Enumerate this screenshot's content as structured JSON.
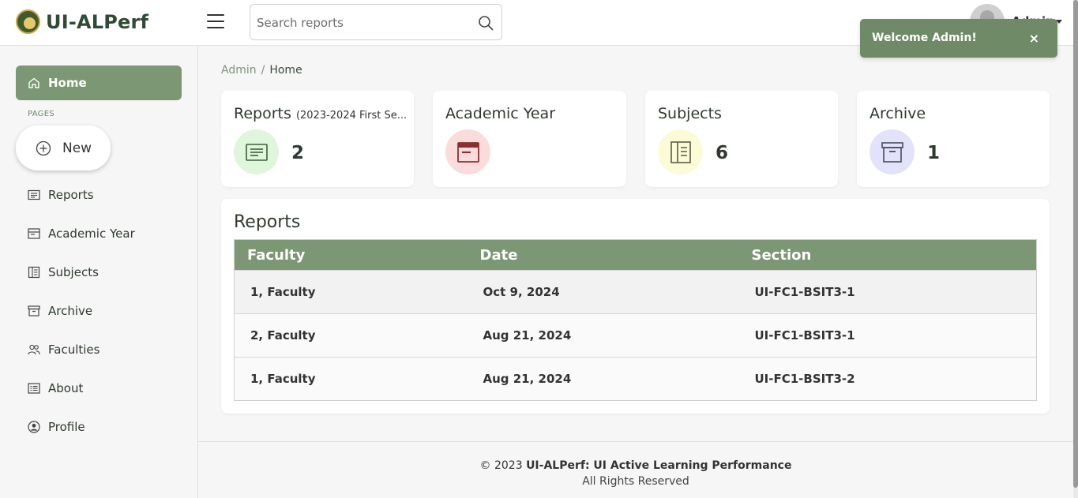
{
  "header": {
    "app_name": "UI-ALPerf",
    "search_placeholder": "Search reports",
    "user_name": "Admin"
  },
  "toast": {
    "message": "Welcome Admin!",
    "close": "×"
  },
  "sidebar": {
    "home": "Home",
    "section_label": "PAGES",
    "new_button": "New",
    "items": [
      {
        "label": "Reports",
        "icon": "reports-icon"
      },
      {
        "label": "Academic Year",
        "icon": "calendar-icon"
      },
      {
        "label": "Subjects",
        "icon": "book-icon"
      },
      {
        "label": "Archive",
        "icon": "archive-icon"
      },
      {
        "label": "Faculties",
        "icon": "people-icon"
      },
      {
        "label": "About",
        "icon": "info-list-icon"
      },
      {
        "label": "Profile",
        "icon": "user-circle-icon"
      }
    ]
  },
  "breadcrumb": {
    "parent": "Admin",
    "separator": "/",
    "current": "Home"
  },
  "cards": [
    {
      "title": "Reports",
      "subtitle": "(2023-2024 First Se...",
      "value": "2",
      "icon": "reports-icon",
      "icon_bg": "#dff5dc",
      "icon_color": "#3e5f3a"
    },
    {
      "title": "Academic Year",
      "subtitle": "",
      "value": "",
      "icon": "calendar-icon",
      "icon_bg": "#fadcdc",
      "icon_color": "#8a3030"
    },
    {
      "title": "Subjects",
      "subtitle": "",
      "value": "6",
      "icon": "book-icon",
      "icon_bg": "#fbfbd8",
      "icon_color": "#5d5d48"
    },
    {
      "title": "Archive",
      "subtitle": "",
      "value": "1",
      "icon": "archive-icon",
      "icon_bg": "#e2e3fa",
      "icon_color": "#4a4a5f"
    }
  ],
  "reports": {
    "title": "Reports",
    "columns": [
      "Faculty",
      "Date",
      "Section"
    ],
    "rows": [
      [
        "1, Faculty",
        "Oct 9, 2024",
        "UI-FC1-BSIT3-1"
      ],
      [
        "2, Faculty",
        "Aug 21, 2024",
        "UI-FC1-BSIT3-1"
      ],
      [
        "1, Faculty",
        "Aug 21, 2024",
        "UI-FC1-BSIT3-2"
      ]
    ]
  },
  "footer": {
    "copyright": "© 2023",
    "brand": "UI-ALPerf: UI Active Learning Performance",
    "rights": "All Rights Reserved"
  },
  "theme": {
    "accent": "#7b9774",
    "toast": "#6f8a66"
  }
}
